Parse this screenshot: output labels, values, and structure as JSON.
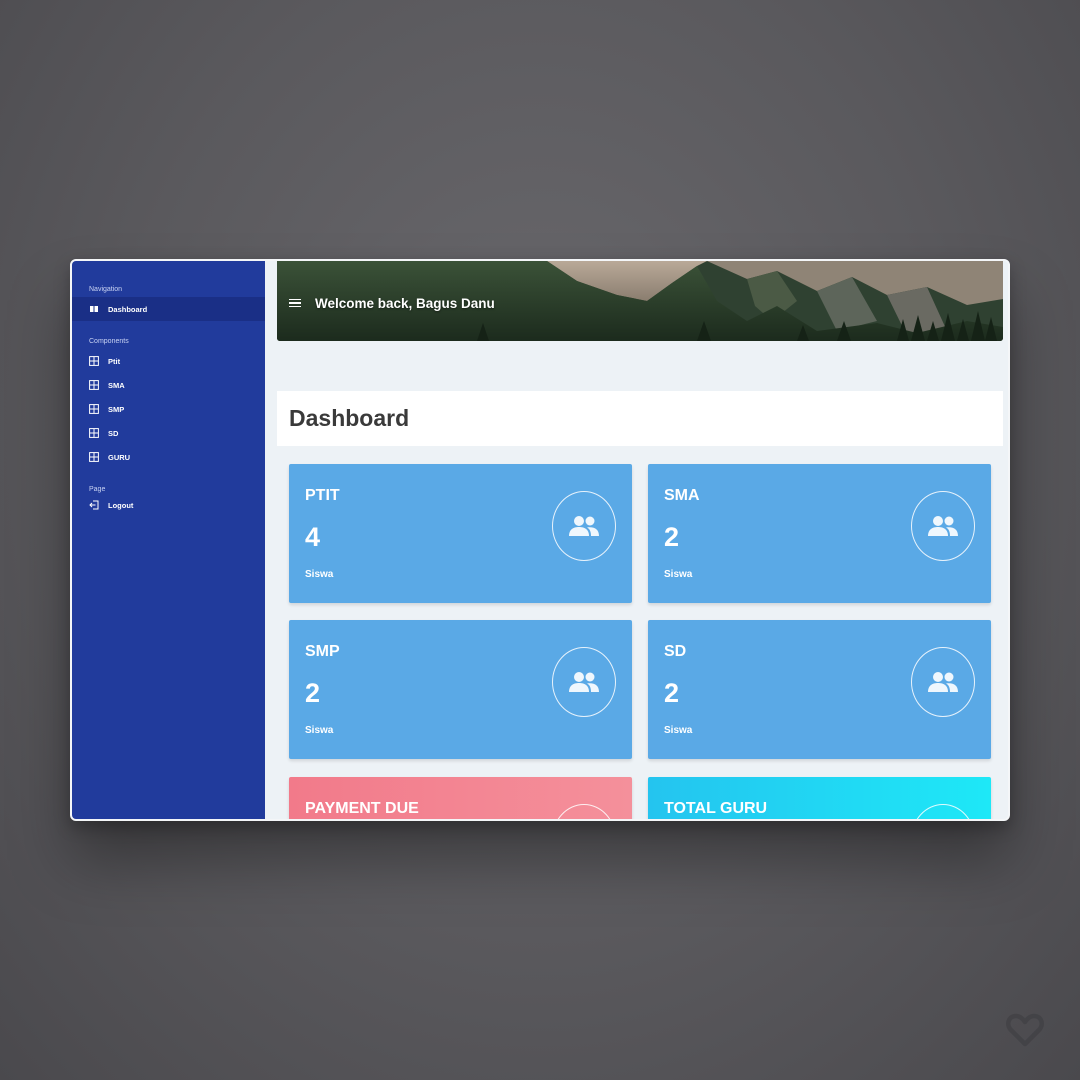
{
  "sidebar": {
    "sections": {
      "navigation": "Navigation",
      "components": "Components",
      "page": "Page"
    },
    "items": {
      "dashboard": "Dashboard",
      "ptit": "Ptit",
      "sma": "SMA",
      "smp": "SMP",
      "sd": "SD",
      "guru": "GURU",
      "logout": "Logout"
    }
  },
  "header": {
    "welcome": "Welcome back, Bagus Danu"
  },
  "page": {
    "title": "Dashboard"
  },
  "cards": [
    {
      "label": "PTIT",
      "value": "4",
      "unit": "Siswa",
      "icon": "users-icon"
    },
    {
      "label": "SMA",
      "value": "2",
      "unit": "Siswa",
      "icon": "users-icon"
    },
    {
      "label": "SMP",
      "value": "2",
      "unit": "Siswa",
      "icon": "users-icon"
    },
    {
      "label": "SD",
      "value": "2",
      "unit": "Siswa",
      "icon": "users-icon"
    },
    {
      "label": "PAYMENT DUE",
      "value": "",
      "unit": "",
      "icon": "users-icon"
    },
    {
      "label": "TOTAL GURU",
      "value": "",
      "unit": "",
      "icon": "users-icon"
    }
  ],
  "colors": {
    "sidebar": "#213b9c",
    "sidebar_active": "#1a2f86",
    "card_blue": "#5aa9e6",
    "card_pink": "#f27a8a",
    "card_cyan": "#1ee8f7",
    "content_bg": "#edf2f6"
  }
}
